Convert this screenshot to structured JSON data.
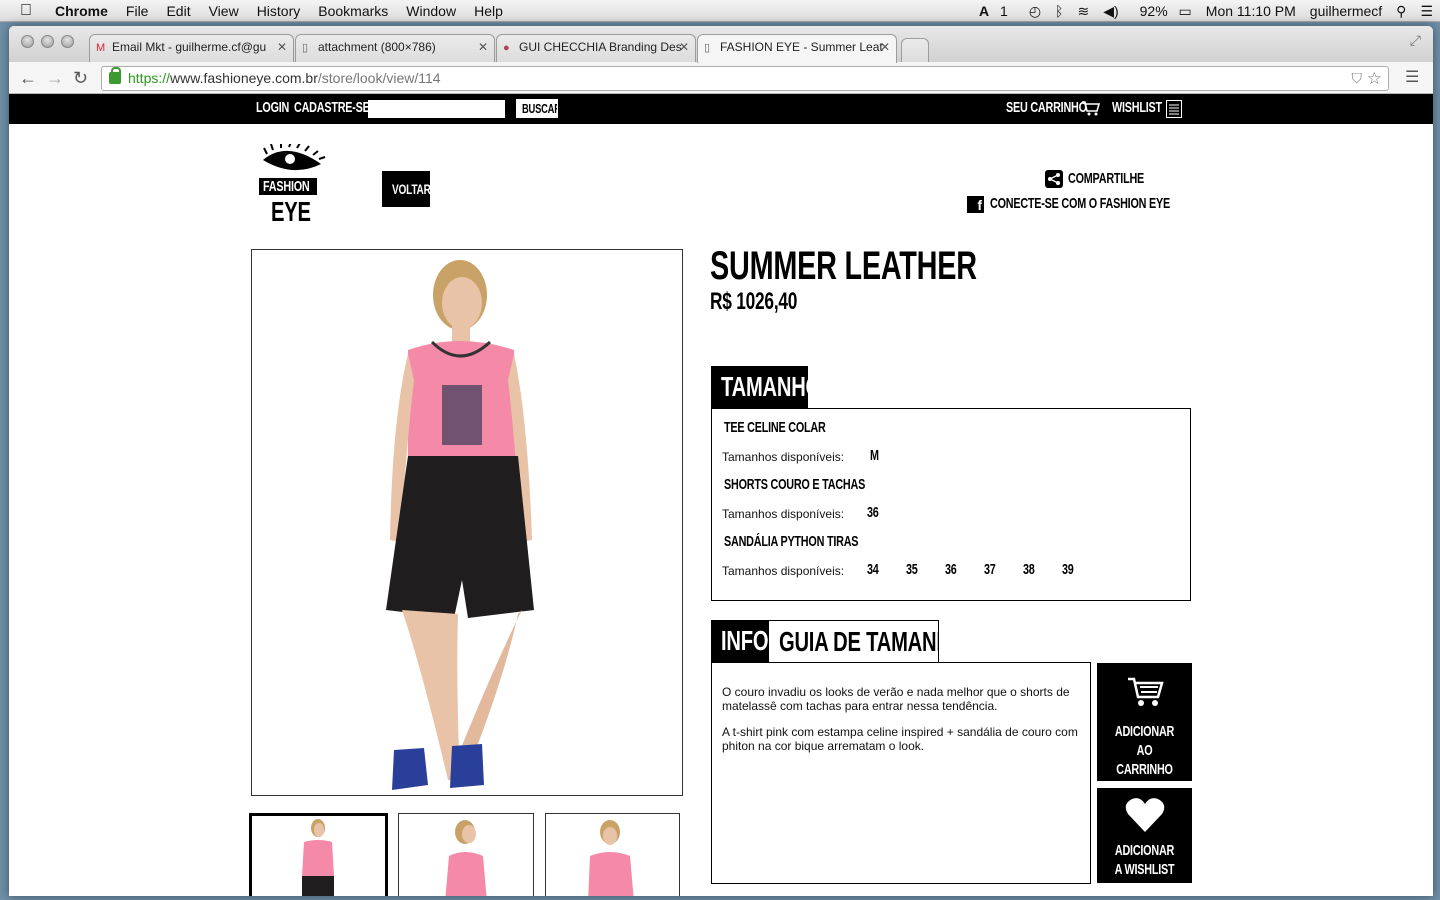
{
  "menubar": {
    "app": "Chrome",
    "items": [
      "File",
      "Edit",
      "View",
      "History",
      "Bookmarks",
      "Window",
      "Help"
    ],
    "status": {
      "adobe": "1",
      "battery": "92%",
      "clock": "Mon 11:10 PM",
      "user": "guilhermecf"
    }
  },
  "tabs": [
    {
      "title": "Email Mkt - guilherme.cf@gu",
      "icon": "gmail-icon"
    },
    {
      "title": "attachment (800×786)",
      "icon": "page-icon"
    },
    {
      "title": "GUI CHECCHIA Branding Des",
      "icon": "avatar-icon"
    },
    {
      "title": "FASHION EYE - Summer Leat",
      "icon": "page-icon",
      "active": true
    }
  ],
  "address": {
    "scheme": "https://",
    "host": "www.fashioneye.com.br",
    "path": "/store/look/view/114"
  },
  "site": {
    "topbar": {
      "login": "LOGIN",
      "signup": "CADASTRE-SE",
      "search_button": "BUSCAR",
      "cart": "SEU CARRINHO",
      "wishlist": "WISHLIST"
    },
    "logo": {
      "line1": "FASHION",
      "line2": "EYE"
    },
    "back": "VOLTAR",
    "share": "COMPARTILHE",
    "connect": "CONECTE-SE COM O FASHION EYE",
    "product": {
      "title": "SUMMER LEATHER",
      "price": "R$ 1026,40"
    },
    "size_tab": "TAMANHO",
    "available_label": "Tamanhos disponíveis:",
    "items": [
      {
        "name": "TEE CELINE COLAR",
        "sizes": [
          "M"
        ]
      },
      {
        "name": "SHORTS COURO E TACHAS",
        "sizes": [
          "36"
        ]
      },
      {
        "name": "SANDÁLIA PYTHON TIRAS",
        "sizes": [
          "34",
          "35",
          "36",
          "37",
          "38",
          "39"
        ]
      }
    ],
    "info_tab": "INFO",
    "guide_tab": "GUIA DE TAMANHOS",
    "description": [
      "O couro invadiu os looks de verão e nada melhor que o shorts de matelassê com tachas para entrar nessa tendência.",
      "A t-shirt pink com estampa celine inspired + sandália de couro com phiton na cor bique arrematam o look."
    ],
    "add_to_cart": "ADICIONAR AO CARRINHO",
    "add_to_wishlist": "ADICIONAR A WISHLIST",
    "colors": {
      "shirt": "#f48aa8",
      "shorts": "#1f1d1d",
      "skin": "#e9c3a8",
      "hair": "#c9a268",
      "sandal": "#2a3f9a"
    }
  }
}
